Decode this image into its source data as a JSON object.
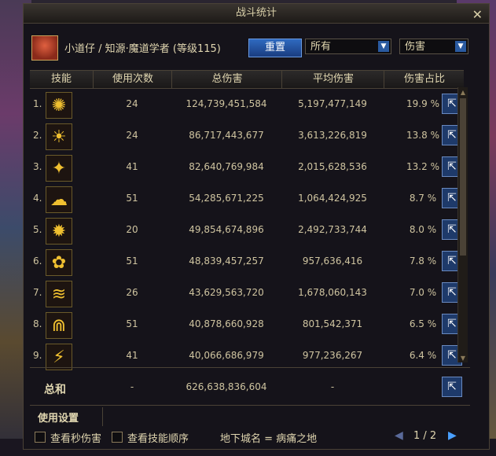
{
  "window": {
    "title": "战斗统计",
    "close": "✕"
  },
  "player": {
    "name_line": "小道仔 / 知源·魔道学者 (等级115)"
  },
  "controls": {
    "reset_label": "重置",
    "filter_select": "所有",
    "metric_select": "伤害"
  },
  "table": {
    "headers": [
      "技能",
      "使用次数",
      "总伤害",
      "平均伤害",
      "伤害占比"
    ],
    "rows": [
      {
        "n": "1.",
        "uses": "24",
        "total": "124,739,451,584",
        "avg": "5,197,477,149",
        "pct": "19.9 %",
        "icon": "skill-icon-1"
      },
      {
        "n": "2.",
        "uses": "24",
        "total": "86,717,443,677",
        "avg": "3,613,226,819",
        "pct": "13.8 %",
        "icon": "skill-icon-2"
      },
      {
        "n": "3.",
        "uses": "41",
        "total": "82,640,769,984",
        "avg": "2,015,628,536",
        "pct": "13.2 %",
        "icon": "skill-icon-3"
      },
      {
        "n": "4.",
        "uses": "51",
        "total": "54,285,671,225",
        "avg": "1,064,424,925",
        "pct": "8.7 %",
        "icon": "skill-icon-4"
      },
      {
        "n": "5.",
        "uses": "20",
        "total": "49,854,674,896",
        "avg": "2,492,733,744",
        "pct": "8.0 %",
        "icon": "skill-icon-5"
      },
      {
        "n": "6.",
        "uses": "51",
        "total": "48,839,457,257",
        "avg": "957,636,416",
        "pct": "7.8 %",
        "icon": "skill-icon-6"
      },
      {
        "n": "7.",
        "uses": "26",
        "total": "43,629,563,720",
        "avg": "1,678,060,143",
        "pct": "7.0 %",
        "icon": "skill-icon-7"
      },
      {
        "n": "8.",
        "uses": "51",
        "total": "40,878,660,928",
        "avg": "801,542,371",
        "pct": "6.5 %",
        "icon": "skill-icon-8"
      },
      {
        "n": "9.",
        "uses": "41",
        "total": "40,066,686,979",
        "avg": "977,236,267",
        "pct": "6.4 %",
        "icon": "skill-icon-9"
      }
    ],
    "total": {
      "label": "总和",
      "uses": "-",
      "total": "626,638,836,604",
      "avg": "-"
    }
  },
  "settings_label": "使用设置",
  "footer": {
    "dps_label": "查看秒伤害",
    "order_label": "查看技能顺序",
    "dungeon": "地下城名 = 病痛之地",
    "page": "1 / 2"
  }
}
